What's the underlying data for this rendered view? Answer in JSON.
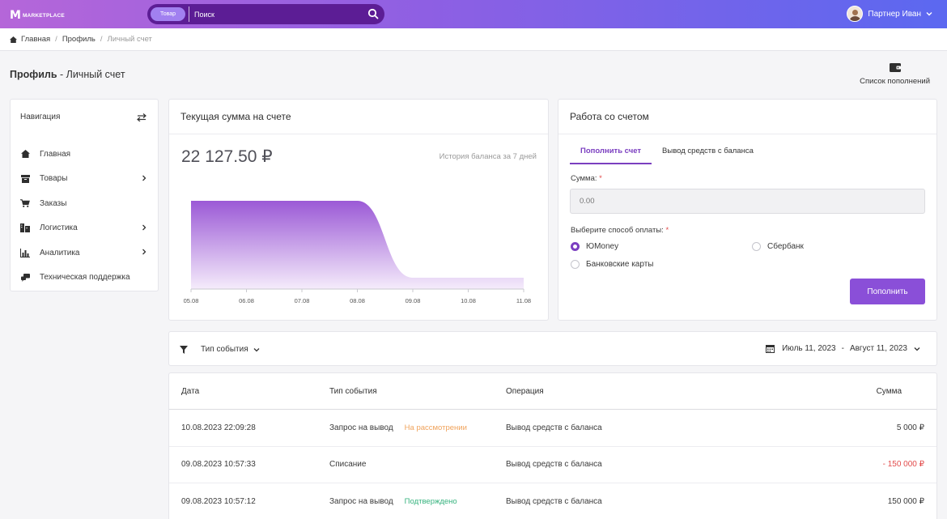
{
  "topbar": {
    "logo_mark": "M",
    "logo_text": "MARKETPLACE",
    "search_chip": "Товар",
    "search_placeholder": "Поиск",
    "user_name": "Партнер Иван",
    "icons": [
      "search-icon",
      "chevron-down-icon"
    ]
  },
  "breadcrumb": {
    "home": "Главная",
    "profile": "Профиль",
    "current": "Личный счет"
  },
  "page": {
    "title_bold": "Профиль",
    "title_rest": " - Личный счет",
    "topup_list_label": "Список пополнений"
  },
  "nav": {
    "title": "Навигация",
    "items": [
      {
        "label": "Главная",
        "icon": "home-icon",
        "has_submenu": false
      },
      {
        "label": "Товары",
        "icon": "box-icon",
        "has_submenu": true
      },
      {
        "label": "Заказы",
        "icon": "cart-icon",
        "has_submenu": false
      },
      {
        "label": "Логистика",
        "icon": "truck-icon",
        "has_submenu": true
      },
      {
        "label": "Аналитика",
        "icon": "bar-chart-icon",
        "has_submenu": true
      },
      {
        "label": "Техническая поддержка",
        "icon": "support-icon",
        "has_submenu": false
      }
    ]
  },
  "balance": {
    "title": "Текущая сумма на счете",
    "amount": "22 127.50 ₽",
    "history_label": "История баланса за 7 дней"
  },
  "chart_data": {
    "type": "area",
    "title": "",
    "xlabel": "",
    "ylabel": "",
    "x": [
      "05.08",
      "06.08",
      "07.08",
      "08.08",
      "09.08",
      "10.08",
      "11.08"
    ],
    "series": [
      {
        "values": [
          172127.5,
          172127.5,
          172127.5,
          172127.5,
          22127.5,
          22127.5,
          22127.5
        ]
      }
    ],
    "ylim": [
      0,
      180000
    ],
    "grid": false,
    "colors": {
      "top": "#9b59d6",
      "bottom": "#f3e9fb"
    }
  },
  "account": {
    "title": "Работа со счетом",
    "tab_topup": "Пополнить счет",
    "tab_withdraw": "Вывод средств с баланса",
    "amount_label": "Сумма:",
    "amount_placeholder": "0.00",
    "payment_label": "Выберите способ оплаты:",
    "required_mark": "*",
    "methods": [
      {
        "label": "ЮMoney",
        "selected": true
      },
      {
        "label": "Сбербанк",
        "selected": false
      },
      {
        "label": "Банковские карты",
        "selected": false
      }
    ],
    "submit": "Пополнить"
  },
  "filter": {
    "event_type": "Тип события",
    "date_from": "Июль 11, 2023",
    "date_sep": "-",
    "date_to": "Август 11, 2023"
  },
  "table": {
    "columns": [
      "Дата",
      "Тип события",
      "Операция",
      "Сумма"
    ],
    "rows": [
      {
        "date": "10.08.2023 22:09:28",
        "event": "Запрос на вывод",
        "status": "На рассмотрении",
        "operation": "Вывод средств с баланса",
        "amount": "5 000 ₽"
      },
      {
        "date": "09.08.2023 10:57:33",
        "event": "Списание",
        "status": "",
        "operation": "Вывод средств с баланса",
        "amount": "- 150 000 ₽"
      },
      {
        "date": "09.08.2023 10:57:12",
        "event": "Запрос на вывод",
        "status": "Подтверждено",
        "operation": "Вывод средств с баланса",
        "amount": "150 000 ₽"
      }
    ]
  },
  "colors": {
    "accent": "#7b3fc0",
    "pending": "#f0a35c",
    "confirmed": "#36b37e",
    "negative": "#e24c4c"
  }
}
